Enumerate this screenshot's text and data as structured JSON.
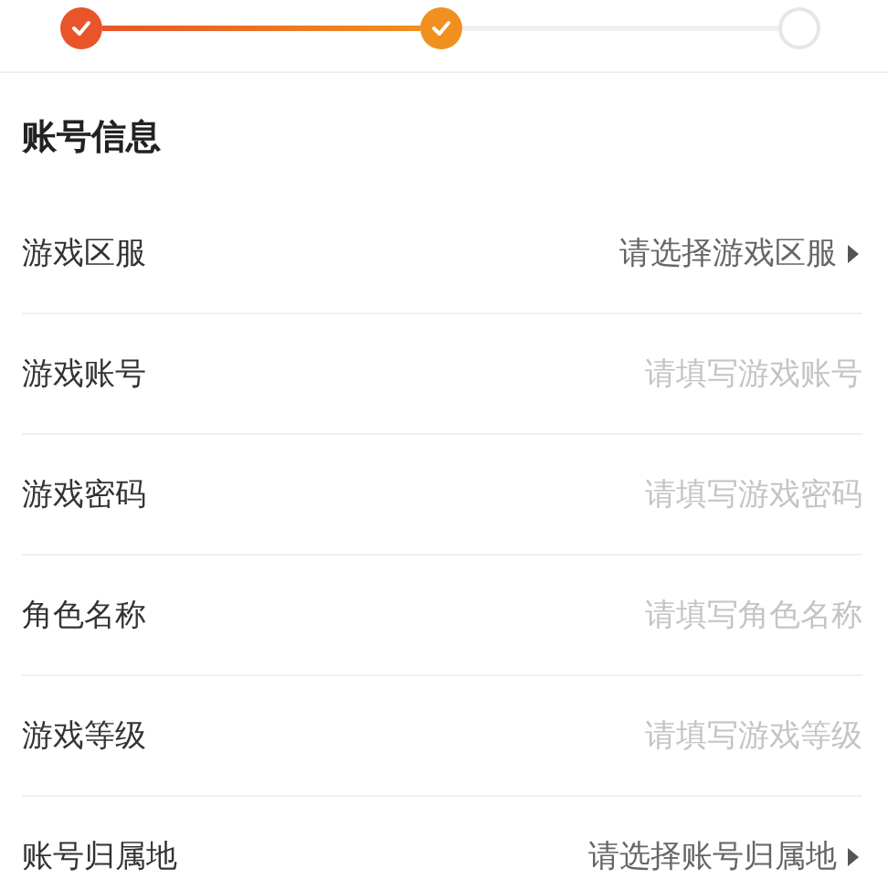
{
  "steps": [
    {
      "done": true,
      "color": "#e8552a"
    },
    {
      "done": true,
      "color": "#f0901e"
    },
    {
      "done": false,
      "color": "#e6e6e6"
    }
  ],
  "section": {
    "title": "账号信息"
  },
  "fields": [
    {
      "kind": "select",
      "label": "游戏区服",
      "value": "请选择游戏区服"
    },
    {
      "kind": "input",
      "label": "游戏账号",
      "placeholder": "请填写游戏账号"
    },
    {
      "kind": "input",
      "label": "游戏密码",
      "placeholder": "请填写游戏密码"
    },
    {
      "kind": "input",
      "label": "角色名称",
      "placeholder": "请填写角色名称"
    },
    {
      "kind": "input",
      "label": "游戏等级",
      "placeholder": "请填写游戏等级"
    },
    {
      "kind": "select",
      "label": "账号归属地",
      "value": "请选择账号归属地"
    }
  ]
}
